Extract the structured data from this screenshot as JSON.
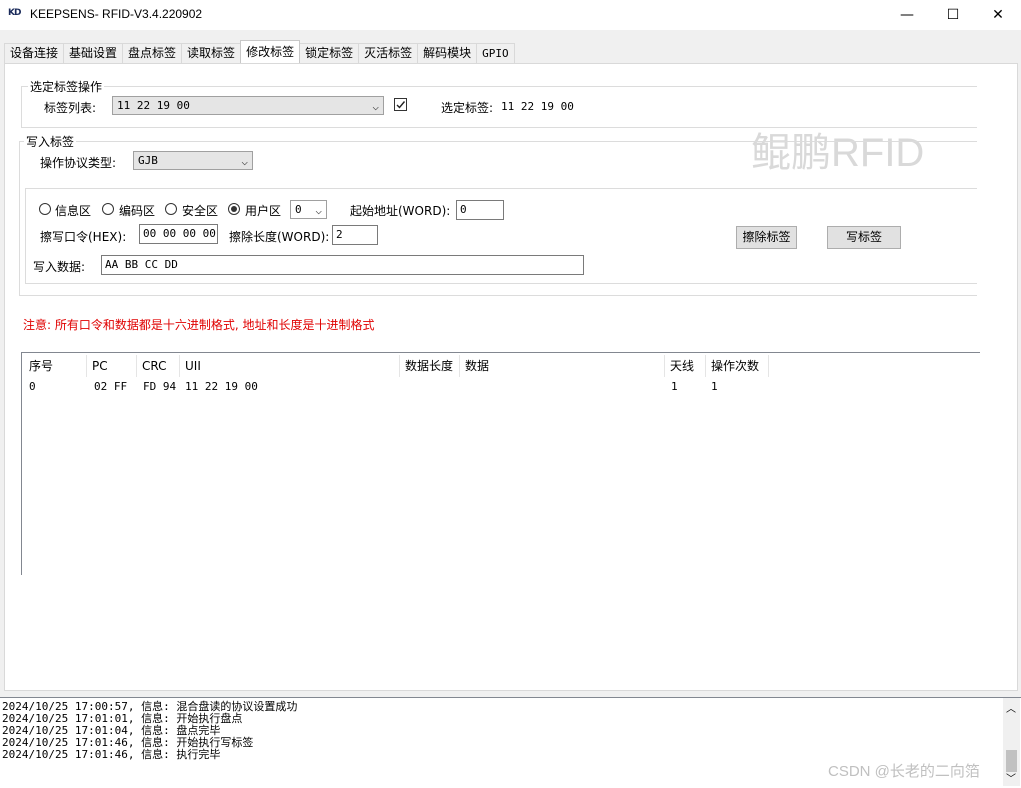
{
  "window": {
    "icon_text": "KD",
    "title": "KEEPSENS- RFID-V3.4.220902",
    "minimize_glyph": "—",
    "maximize_glyph": "☐",
    "close_glyph": "✕"
  },
  "tabs": [
    {
      "label": "设备连接"
    },
    {
      "label": "基础设置"
    },
    {
      "label": "盘点标签"
    },
    {
      "label": "读取标签"
    },
    {
      "label": "修改标签",
      "active": true
    },
    {
      "label": "锁定标签"
    },
    {
      "label": "灭活标签"
    },
    {
      "label": "解码模块"
    },
    {
      "label": "GPIO"
    }
  ],
  "select_group": {
    "title": "选定标签操作",
    "tag_list_label": "标签列表:",
    "tag_list_value": "11 22 19 00",
    "checkbox_checked": true,
    "selected_label": "选定标签:",
    "selected_value": "11 22 19 00"
  },
  "watermark": "鲲鹏RFID",
  "write_group": {
    "title": "写入标签",
    "protocol_label": "操作协议类型:",
    "protocol_value": "GJB",
    "regions": [
      {
        "label": "信息区",
        "checked": false
      },
      {
        "label": "编码区",
        "checked": false
      },
      {
        "label": "安全区",
        "checked": false
      },
      {
        "label": "用户区",
        "checked": true
      }
    ],
    "region_index_value": "0",
    "start_addr_label": "起始地址(WORD):",
    "start_addr_value": "0",
    "password_label": "擦写口令(HEX):",
    "password_value": "00 00 00 00",
    "erase_len_label": "擦除长度(WORD):",
    "erase_len_value": "2",
    "data_label": "写入数据:",
    "data_value": "AA BB CC DD",
    "erase_button": "擦除标签",
    "write_button": "写标签"
  },
  "notice": {
    "text": "注意: 所有口令和数据都是十六进制格式, 地址和长度是十进制格式",
    "color": "#e00000"
  },
  "table": {
    "columns": [
      "序号",
      "PC",
      "CRC",
      "UII",
      "数据长度",
      "数据",
      "天线",
      "操作次数"
    ],
    "rows": [
      [
        "0",
        "02 FF",
        "FD 94",
        "11 22 19 00",
        "",
        "",
        "1",
        "1"
      ]
    ]
  },
  "log": {
    "lines": [
      "2024/10/25 17:00:57, 信息: 混合盘读的协议设置成功",
      "2024/10/25 17:01:01, 信息: 开始执行盘点",
      "2024/10/25 17:01:04, 信息: 盘点完毕",
      "2024/10/25 17:01:46, 信息: 开始执行写标签",
      "2024/10/25 17:01:46, 信息: 执行完毕"
    ],
    "credit": "CSDN @长老的二向箔",
    "scroll_up_glyph": "︿",
    "scroll_down_glyph": "﹀"
  }
}
